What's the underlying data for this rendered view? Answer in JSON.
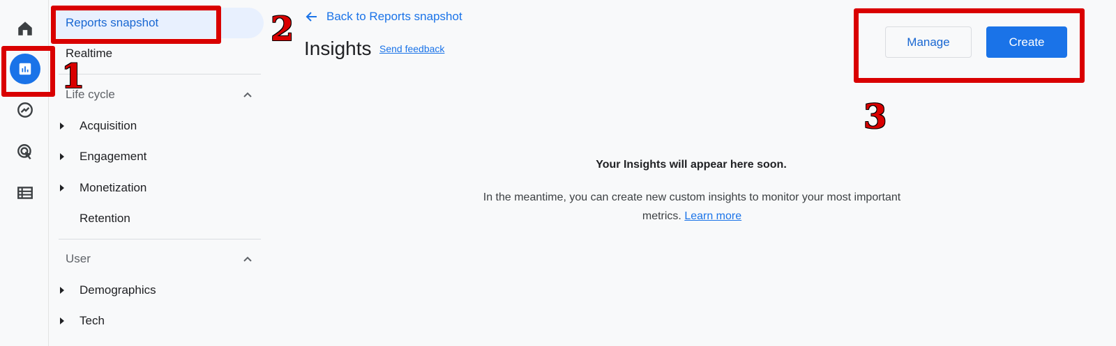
{
  "rail": {
    "items": [
      {
        "icon": "home-icon",
        "active": false
      },
      {
        "icon": "reports-icon",
        "active": true
      },
      {
        "icon": "explore-icon",
        "active": false
      },
      {
        "icon": "advertising-icon",
        "active": false
      },
      {
        "icon": "configure-icon",
        "active": false
      }
    ]
  },
  "nav": {
    "reports_snapshot": "Reports snapshot",
    "realtime": "Realtime",
    "lifecycle": {
      "label": "Life cycle",
      "items": [
        "Acquisition",
        "Engagement",
        "Monetization",
        "Retention"
      ]
    },
    "user": {
      "label": "User",
      "items": [
        "Demographics",
        "Tech"
      ]
    }
  },
  "main": {
    "back_label": "Back to Reports snapshot",
    "title": "Insights",
    "feedback": "Send feedback",
    "manage_label": "Manage",
    "create_label": "Create",
    "empty_title": "Your Insights will appear here soon.",
    "empty_text": "In the meantime, you can create new custom insights to monitor your most important metrics.",
    "learn_more": "Learn more"
  },
  "annotations": {
    "one": "1",
    "two": "2",
    "three": "3"
  },
  "colors": {
    "accent": "#1a73e8",
    "annotation": "#d90000",
    "background": "#f8f9fa"
  }
}
